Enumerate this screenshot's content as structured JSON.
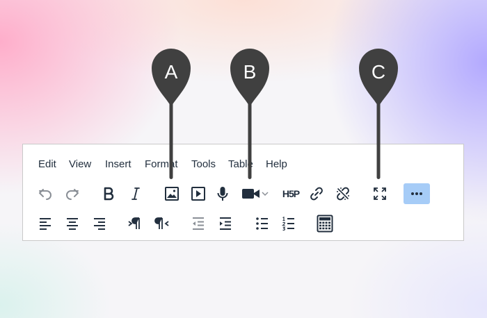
{
  "menubar": {
    "items": [
      {
        "label": "Edit"
      },
      {
        "label": "View"
      },
      {
        "label": "Insert"
      },
      {
        "label": "Format"
      },
      {
        "label": "Tools"
      },
      {
        "label": "Table"
      },
      {
        "label": "Help"
      }
    ]
  },
  "toolbar_row1": [
    {
      "name": "undo",
      "icon": "undo-icon",
      "state": "disabled"
    },
    {
      "name": "redo",
      "icon": "redo-icon",
      "state": "disabled"
    },
    {
      "name": "bold",
      "icon": "bold-icon"
    },
    {
      "name": "italic",
      "icon": "italic-icon"
    },
    {
      "name": "insert-image",
      "icon": "image-icon"
    },
    {
      "name": "insert-media",
      "icon": "play-icon"
    },
    {
      "name": "record-audio",
      "icon": "microphone-icon"
    },
    {
      "name": "record-video",
      "icon": "video-camera-icon",
      "has_dropdown": true
    },
    {
      "name": "h5p",
      "icon": "h5p-icon"
    },
    {
      "name": "link",
      "icon": "link-icon"
    },
    {
      "name": "unlink",
      "icon": "unlink-icon"
    },
    {
      "name": "fullscreen",
      "icon": "fullscreen-icon"
    },
    {
      "name": "more",
      "icon": "more-icon",
      "state": "active"
    }
  ],
  "toolbar_row2": [
    {
      "name": "align-left",
      "icon": "align-left-icon"
    },
    {
      "name": "align-center",
      "icon": "align-center-icon"
    },
    {
      "name": "align-right",
      "icon": "align-right-icon"
    },
    {
      "name": "ltr",
      "icon": "ltr-icon"
    },
    {
      "name": "rtl",
      "icon": "rtl-icon"
    },
    {
      "name": "outdent",
      "icon": "outdent-icon",
      "state": "disabled"
    },
    {
      "name": "indent",
      "icon": "indent-icon"
    },
    {
      "name": "bullet-list",
      "icon": "bullet-list-icon"
    },
    {
      "name": "numbered-list",
      "icon": "numbered-list-icon"
    },
    {
      "name": "equation",
      "icon": "calculator-icon"
    }
  ],
  "h5p_text": "H5P",
  "callouts": [
    {
      "letter": "A"
    },
    {
      "letter": "B"
    },
    {
      "letter": "C"
    }
  ],
  "colors": {
    "icon": "#222f3e",
    "icon_disabled": "#8a8f96",
    "active_bg": "#a6ccf7",
    "callout": "#404040"
  }
}
